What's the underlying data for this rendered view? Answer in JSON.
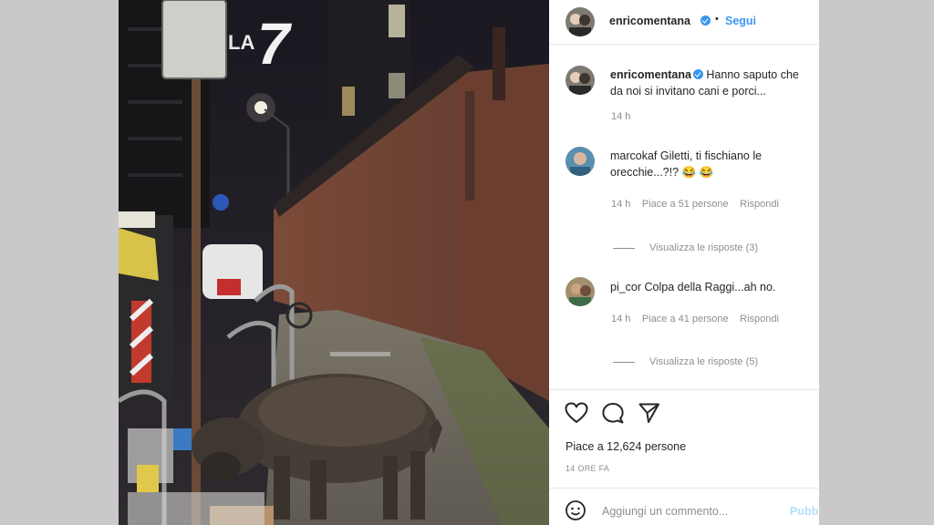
{
  "post": {
    "author": "enricomentana",
    "follow_separator": "•",
    "follow_label": "Segui",
    "caption": {
      "username": "enricomentana",
      "text_line1": "Hanno saputo che",
      "text_line2": "da noi si invitano cani e porci...",
      "time": "14 h"
    },
    "comments": [
      {
        "username": "marcokaf",
        "text_line1": "Giletti, ti fischiano le",
        "text_line2": "orecchie...?!? 😂 😂",
        "time": "14 h",
        "likes": "Piace a 51 persone",
        "reply": "Rispondi",
        "view_replies": "Visualizza le risposte (3)"
      },
      {
        "username": "pi_cor",
        "text_line1": "Colpa della Raggi...ah no.",
        "time": "14 h",
        "likes": "Piace a 41 persone",
        "reply": "Rispondi",
        "view_replies": "Visualizza le risposte (5)"
      }
    ],
    "likes_total": "Piace a 12,624 persone",
    "date": "14 ORE FA",
    "add_comment_placeholder": "Aggiungi un commento...",
    "publish_label": "Pubb"
  },
  "photo": {
    "sign_text": "LA",
    "sign_number": "7"
  },
  "icons": {
    "like": "heart-icon",
    "comment": "comment-icon",
    "share": "share-icon",
    "emoji": "emoji-icon"
  },
  "colors": {
    "link_blue": "#3897f0",
    "text_dark": "#262626",
    "text_gray": "#8e8e8e"
  }
}
